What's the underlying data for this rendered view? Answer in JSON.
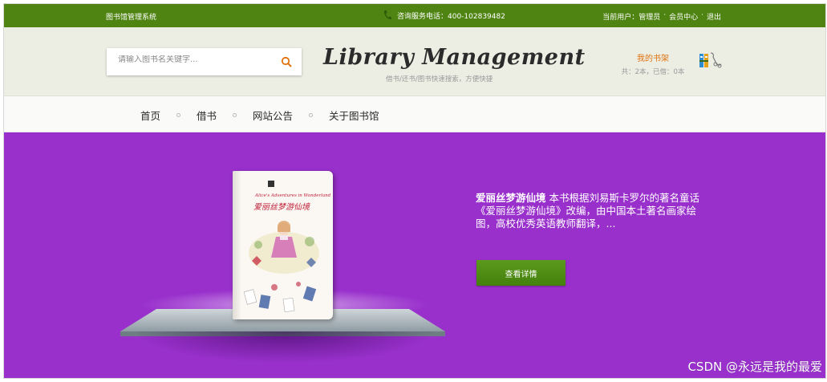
{
  "topbar": {
    "system_name": "图书馆管理系统",
    "phone_label": "咨询服务电话：400-102839482",
    "current_user": "当前用户：管理员",
    "separator": "·",
    "member_center": "会员中心",
    "logout": "退出",
    "bg_color": "#4f8412"
  },
  "header": {
    "search_placeholder": "请输入图书名关键字...",
    "logo": "Library Management",
    "tagline": "借书/还书/图书快速搜索，方便快捷",
    "shelf_title": "我的书架",
    "shelf_counts": "共：2本，已借：0本",
    "icons": [
      "search-icon",
      "books-icon"
    ]
  },
  "nav": {
    "items": [
      "首页",
      "借书",
      "网站公告",
      "关于图书馆"
    ]
  },
  "banner": {
    "bg_color": "#9930cc",
    "book_title": "爱丽丝梦游仙境",
    "description": " 本书根据刘易斯卡罗尔的著名童话《爱丽丝梦游仙境》改编，由中国本土著名画家绘图，高校优秀英语教师翻译，...",
    "detail_button": "查看详情",
    "cover": {
      "subtitle": "Alice's Adventures in Wonderland",
      "title": "爱丽丝梦游仙境"
    }
  },
  "watermark": "CSDN @永远是我的最爱"
}
